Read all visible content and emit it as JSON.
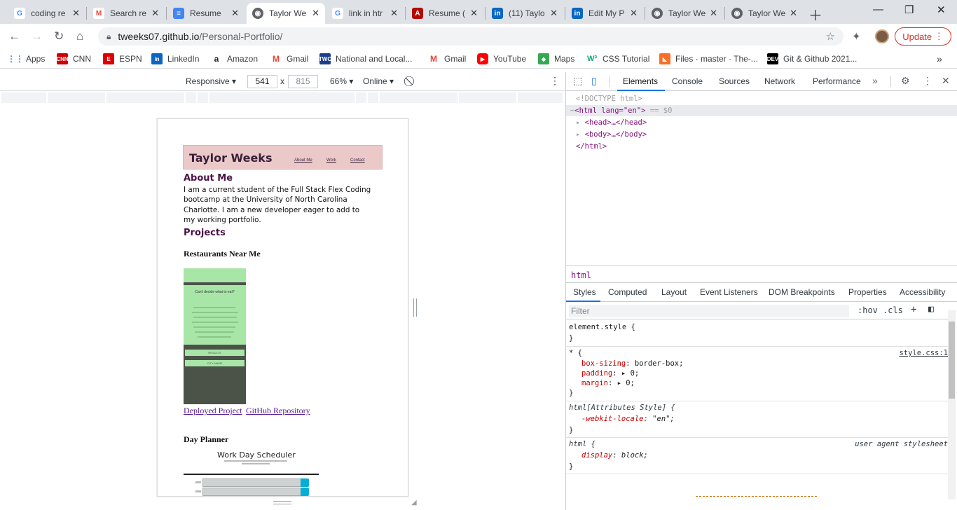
{
  "tabs": [
    {
      "title": "coding re",
      "fav": "G",
      "color": "#4285f4"
    },
    {
      "title": "Search re",
      "fav": "M",
      "color": "#ea4335"
    },
    {
      "title": "Resume",
      "fav": "≡",
      "color": "#4285f4"
    },
    {
      "title": "Taylor We",
      "fav": "◉",
      "color": "#5f6368",
      "active": true
    },
    {
      "title": "link in htr",
      "fav": "G",
      "color": "#4285f4"
    },
    {
      "title": "Resume (",
      "fav": "A",
      "color": "#b30b00"
    },
    {
      "title": "(11) Taylo",
      "fav": "in",
      "color": "#0a66c2"
    },
    {
      "title": "Edit My P",
      "fav": "in",
      "color": "#0a66c2"
    },
    {
      "title": "Taylor We",
      "fav": "◉",
      "color": "#5f6368"
    },
    {
      "title": "Taylor We",
      "fav": "◉",
      "color": "#5f6368"
    }
  ],
  "address": {
    "host": "tweeks07.github.io",
    "path": "/Personal-Portfolio/"
  },
  "update_label": "Update",
  "bookmarks": [
    {
      "label": "Apps",
      "icon": "apps-icon",
      "color": "#4285f4"
    },
    {
      "label": "CNN",
      "icon": "cnn-icon",
      "color": "#cc0000"
    },
    {
      "label": "ESPN",
      "icon": "espn-icon",
      "color": "#d00"
    },
    {
      "label": "LinkedIn",
      "icon": "linkedin-icon",
      "color": "#0a66c2"
    },
    {
      "label": "Amazon",
      "icon": "amazon-icon",
      "color": "#222"
    },
    {
      "label": "Gmail",
      "icon": "gmail-icon",
      "color": "#ea4335"
    },
    {
      "label": "National and Local...",
      "icon": "weather-icon",
      "color": "#1b3e8a"
    },
    {
      "label": "Gmail",
      "icon": "gmail-icon",
      "color": "#ea4335"
    },
    {
      "label": "YouTube",
      "icon": "youtube-icon",
      "color": "#ff0000"
    },
    {
      "label": "Maps",
      "icon": "maps-icon",
      "color": "#34a853"
    },
    {
      "label": "CSS Tutorial",
      "icon": "w3-icon",
      "color": "#04aa6d"
    },
    {
      "label": "Files · master · The-...",
      "icon": "gitlab-icon",
      "color": "#fc6d26"
    },
    {
      "label": "Git & Github 2021...",
      "icon": "dev-icon",
      "color": "#000"
    }
  ],
  "device": {
    "mode": "Responsive",
    "width": "541",
    "height": "815",
    "zoom": "66%",
    "network": "Online",
    "times": "x"
  },
  "portfolio": {
    "name": "Taylor Weeks",
    "nav": [
      "About Me",
      "Work",
      "Contact"
    ],
    "about_heading": "About Me",
    "about_text": "I am a current student of the Full Stack Flex Coding bootcamp at the University of North Carolina Charlotte. I am a new developer eager to add to my working portfolio.",
    "projects_heading": "Projects",
    "project1": "Restaurants Near Me",
    "shot_heading": "Can't decide what to eat?",
    "shot_btn1": "RESULTS",
    "shot_btn2": "CITY NAME",
    "link_deployed": "Deployed Project",
    "link_github": "GitHub Repository",
    "project2": "Day Planner",
    "sched_title": "Work Day Scheduler"
  },
  "devtools": {
    "tabs": [
      "Elements",
      "Console",
      "Sources",
      "Network",
      "Performance"
    ],
    "dom": {
      "doctype": "<!DOCTYPE html>",
      "html_open": "<html lang=\"en\">",
      "eq": "== $0",
      "head": "<head>…</head>",
      "body": "<body>…</body>",
      "html_close": "</html>"
    },
    "crumb": "html",
    "subtabs": [
      "Styles",
      "Computed",
      "Layout",
      "Event Listeners",
      "DOM Breakpoints",
      "Properties",
      "Accessibility"
    ],
    "filter_placeholder": "Filter",
    "hov": ":hov",
    "cls": ".cls",
    "rules": {
      "element_style": "element.style {",
      "star_selector": "* {",
      "star_src": "style.css:1",
      "p1": "box-sizing",
      "v1": "border-box;",
      "p2": "padding",
      "v2": "0;",
      "p3": "margin",
      "v3": "0;",
      "attr_selector": "html[Attributes Style] {",
      "p4": "-webkit-locale",
      "v4": "\"en\";",
      "html_selector": "html {",
      "ua": "user agent stylesheet",
      "p5": "display",
      "v5": "block;",
      "close": "}"
    }
  }
}
